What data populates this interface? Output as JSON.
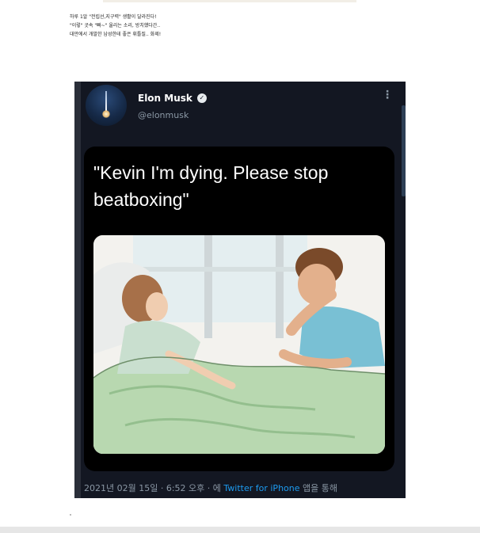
{
  "caption": {
    "line1": "하루 1알 \"전립선,지구력\" 생활이 달라진다!",
    "line2": "\"이렇\" 곳속 \"빠~\" 울리는 소리, 방치했다간..",
    "line3": "대만에서 개발한 남성한테 좋은 휘틀질.. 화제!"
  },
  "tweet": {
    "name": "Elon Musk",
    "handle": "@elonmusk",
    "text": "\"Kevin I'm dying. Please stop beatboxing\"",
    "footer_prefix": "2021년 02월 15일 · 6:52 오후 · 에 ",
    "footer_source": "Twitter for iPhone",
    "footer_suffix": " 앱을 통해"
  },
  "icons": {
    "verified": "verified-badge-icon",
    "more": "more-options-icon"
  },
  "colors": {
    "tweet_bg": "#131722",
    "link": "#1d9bf0",
    "muted": "#8b98a5"
  }
}
